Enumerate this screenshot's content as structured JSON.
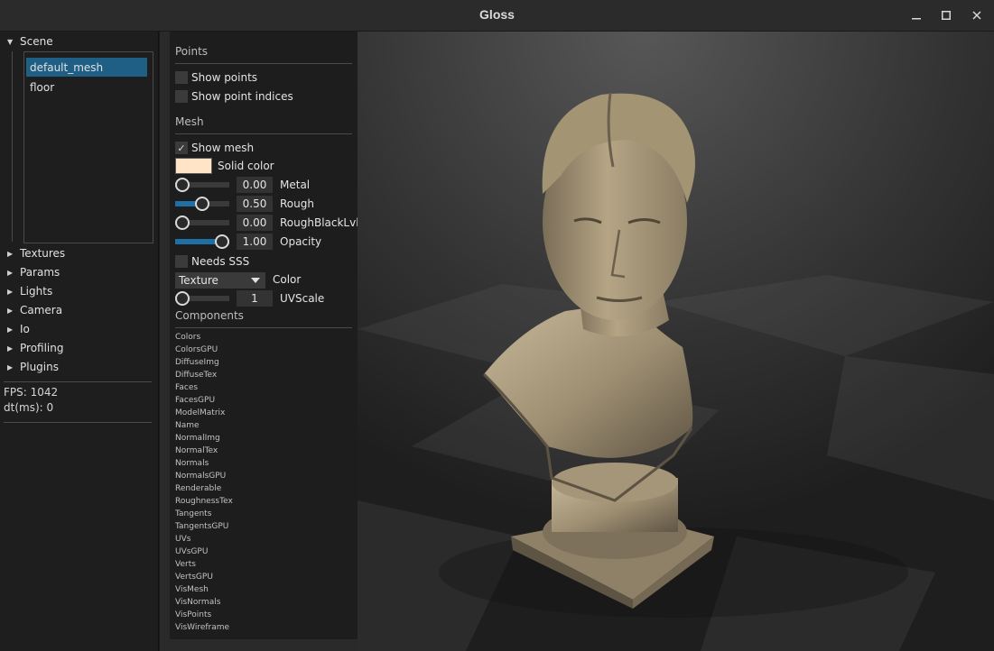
{
  "window": {
    "title": "Gloss",
    "controls": {
      "minimize_icon": "minimize-icon",
      "maximize_icon": "maximize-icon",
      "close_icon": "close-icon"
    }
  },
  "left_panel": {
    "scene_label": "Scene",
    "scene_items": [
      "default_mesh",
      "floor"
    ],
    "selected_item": "default_mesh",
    "tree_items": [
      "Textures",
      "Params",
      "Lights",
      "Camera",
      "Io",
      "Profiling",
      "Plugins"
    ],
    "stats": {
      "fps": "FPS: 1042",
      "dt": "dt(ms): 0"
    }
  },
  "props": {
    "points_header": "Points",
    "show_points": {
      "label": "Show points",
      "checked": false
    },
    "show_point_indices": {
      "label": "Show point indices",
      "checked": false
    },
    "mesh_header": "Mesh",
    "show_mesh": {
      "label": "Show mesh",
      "checked": true,
      "check_glyph": "✓"
    },
    "solid_color": {
      "label": "Solid color",
      "color": "#ffe4c7"
    },
    "sliders": [
      {
        "label": "Metal",
        "value": "0.00",
        "fraction": 0.0
      },
      {
        "label": "Rough",
        "value": "0.50",
        "fraction": 0.5
      },
      {
        "label": "RoughBlackLvl",
        "value": "0.00",
        "fraction": 0.0
      },
      {
        "label": "Opacity",
        "value": "1.00",
        "fraction": 1.0
      }
    ],
    "needs_sss": {
      "label": "Needs SSS",
      "checked": false
    },
    "color_mode": {
      "selected": "Texture",
      "label": "Color"
    },
    "uv_scale": {
      "label": "UVScale",
      "value": "1",
      "fraction": 0.0
    },
    "components_header": "Components",
    "components": [
      "Colors",
      "ColorsGPU",
      "DiffuseImg",
      "DiffuseTex",
      "Faces",
      "FacesGPU",
      "ModelMatrix",
      "Name",
      "NormalImg",
      "NormalTex",
      "Normals",
      "NormalsGPU",
      "Renderable",
      "RoughnessTex",
      "Tangents",
      "TangentsGPU",
      "UVs",
      "UVsGPU",
      "Verts",
      "VertsGPU",
      "VisMesh",
      "VisNormals",
      "VisPoints",
      "VisWireframe"
    ]
  },
  "colors": {
    "accent": "#1f6fa5",
    "selection": "#1f5f86",
    "panel": "#1d1d1d",
    "titlebar": "#2b2b2b"
  }
}
